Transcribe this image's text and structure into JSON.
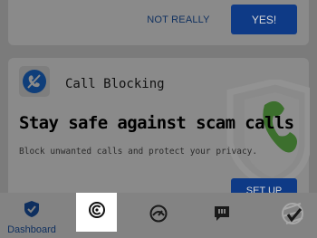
{
  "prompt": {
    "decline_label": "NOT REALLY",
    "accept_label": "YES!"
  },
  "feature": {
    "title": "Call Blocking",
    "headline": "Stay safe against scam calls",
    "description": "Block unwanted calls and protect your privacy.",
    "setup_label": "SET UP"
  },
  "nav": {
    "items": [
      {
        "label": "Dashboard",
        "icon": "shield-check-icon",
        "active": true
      },
      {
        "label": "",
        "icon": "privacy-c-icon",
        "highlighted": true
      },
      {
        "label": "",
        "icon": "speed-gauge-icon"
      },
      {
        "label": "",
        "icon": "message-alert-icon"
      },
      {
        "label": "",
        "icon": "brand-logo-icon"
      }
    ]
  },
  "colors": {
    "accent": "#0e3a86",
    "overlay": "#7b7b7b",
    "highlight": "#ffffff"
  }
}
